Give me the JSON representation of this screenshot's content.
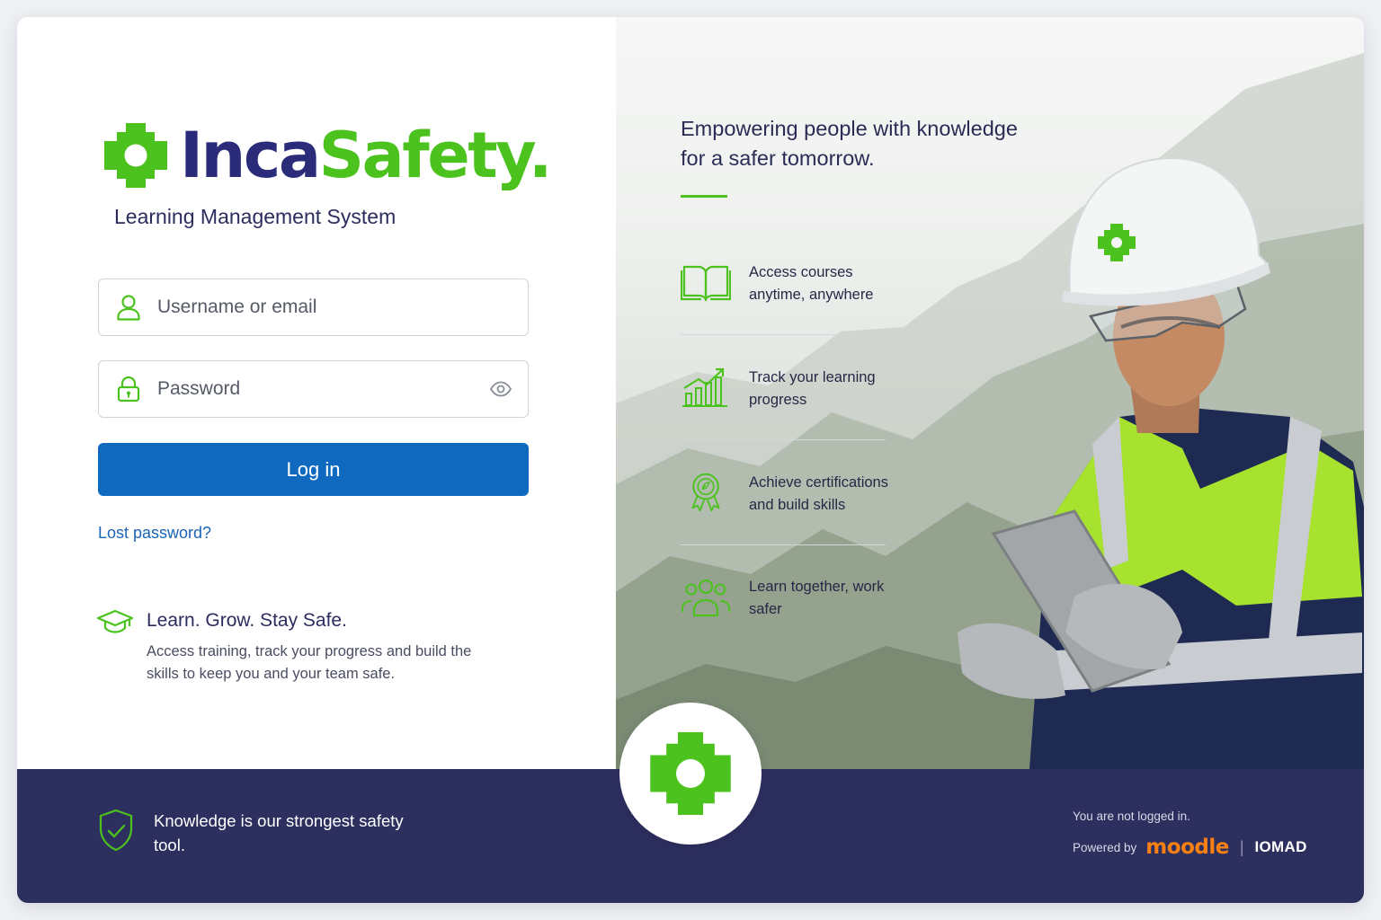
{
  "brand": {
    "name_part1": "Inca",
    "name_part2": "Safety.",
    "subtitle": "Learning Management System",
    "logo_icon": "gear-icon",
    "colors": {
      "navy": "#2a2c7a",
      "green": "#4cc21e",
      "primary_blue": "#0f69bf",
      "footer_bg": "#2d2f5f"
    }
  },
  "login": {
    "username_placeholder": "Username or email",
    "username_value": "",
    "username_icon": "user-icon",
    "password_placeholder": "Password",
    "password_value": "",
    "password_icon": "lock-icon",
    "toggle_icon": "eye-icon",
    "submit_label": "Log in",
    "lost_password_label": "Lost password?"
  },
  "tagline": {
    "icon": "graduation-cap-icon",
    "title": "Learn. Grow. Stay Safe.",
    "description": "Access training, track your progress and build the skills to keep you and your team safe."
  },
  "hero": {
    "headline": "Empowering people with knowledge for a safer tomorrow.",
    "features": [
      {
        "icon": "book-icon",
        "text": "Access courses anytime, anywhere"
      },
      {
        "icon": "growth-chart-icon",
        "text": "Track your learning progress"
      },
      {
        "icon": "certificate-badge-icon",
        "text": "Achieve certifications and build skills"
      },
      {
        "icon": "team-icon",
        "text": "Learn together, work safer"
      }
    ]
  },
  "footer": {
    "icon": "shield-check-icon",
    "quote": "Knowledge is our strongest safety tool.",
    "status": "You are not logged in.",
    "powered_by": "Powered by",
    "moodle": "moodle",
    "separator": "|",
    "iomad": "IOMAD"
  }
}
